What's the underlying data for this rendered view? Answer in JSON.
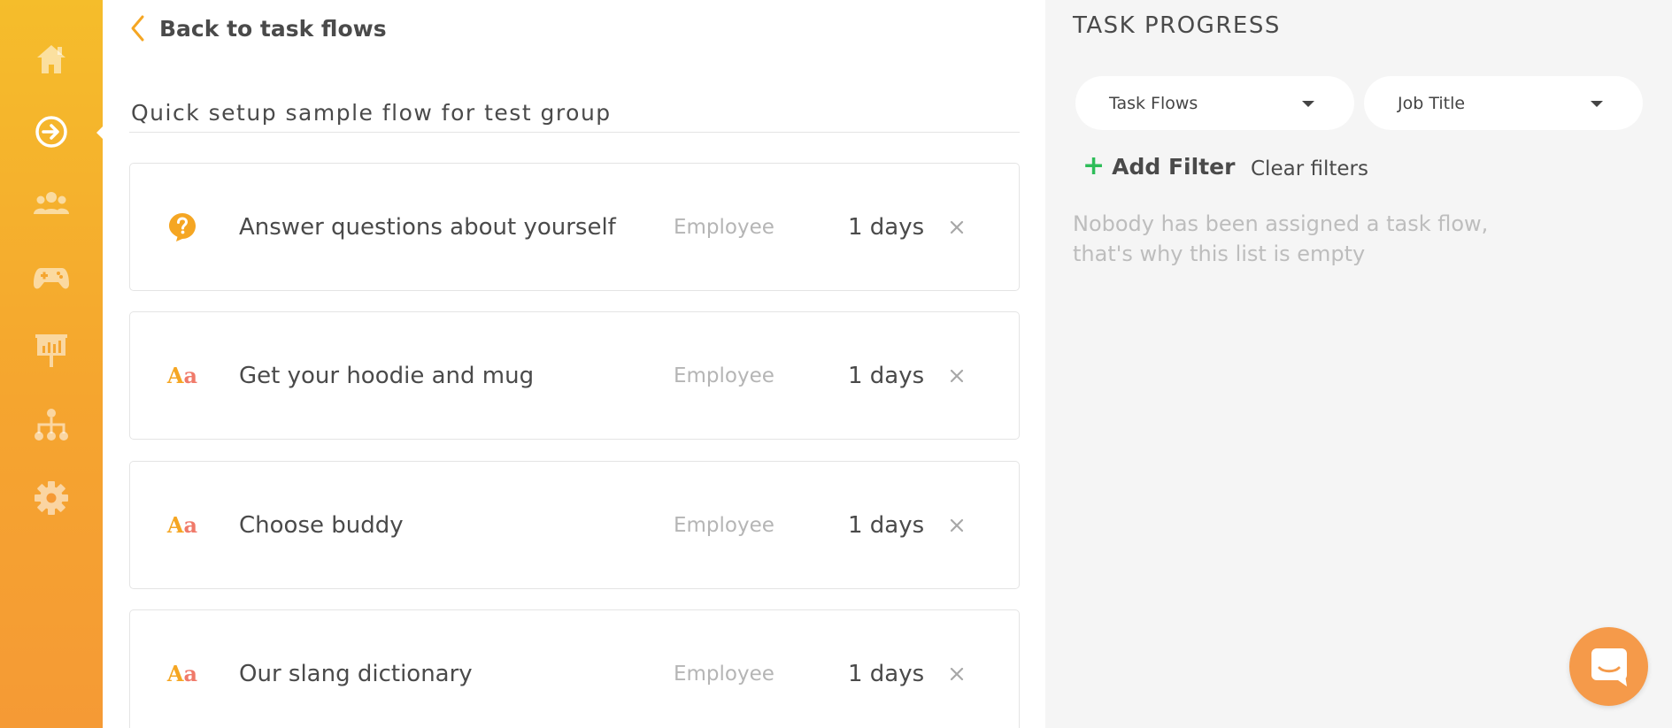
{
  "sidebar": {
    "items": [
      {
        "icon": "home-icon"
      },
      {
        "icon": "arrow-right-circle-icon",
        "active": true
      },
      {
        "icon": "users-icon"
      },
      {
        "icon": "gamepad-icon"
      },
      {
        "icon": "presentation-board-icon"
      },
      {
        "icon": "org-chart-icon"
      },
      {
        "icon": "gear-icon"
      }
    ]
  },
  "main": {
    "back_label": "Back to task flows",
    "flow_title": "Quick setup sample flow for test group",
    "tasks": [
      {
        "icon": "question-bubble-icon",
        "name": "Answer questions about yourself",
        "role": "Employee",
        "duration": "1 days"
      },
      {
        "icon": "text-aa-icon",
        "name": "Get your hoodie and mug",
        "role": "Employee",
        "duration": "1 days"
      },
      {
        "icon": "text-aa-icon",
        "name": "Choose buddy",
        "role": "Employee",
        "duration": "1 days"
      },
      {
        "icon": "text-aa-icon",
        "name": "Our slang dictionary",
        "role": "Employee",
        "duration": "1 days"
      }
    ],
    "aa_glyph": {
      "cap": "A",
      "low": "a"
    }
  },
  "panel": {
    "title": "TASK PROGRESS",
    "filters": {
      "task_flows_label": "Task Flows",
      "job_title_label": "Job Title"
    },
    "add_filter_label": "Add Filter",
    "add_filter_plus": "+",
    "clear_filters_label": "Clear filters",
    "empty_line_1": "Nobody has been assigned a task flow,",
    "empty_line_2": "that's why this list is empty"
  },
  "colors": {
    "accent": "#f5a623",
    "sidebar_top": "#f5bd2b",
    "sidebar_bottom": "#f59a35",
    "add_filter_plus": "#2ebd59",
    "chat_launcher": "#f59a4a"
  }
}
